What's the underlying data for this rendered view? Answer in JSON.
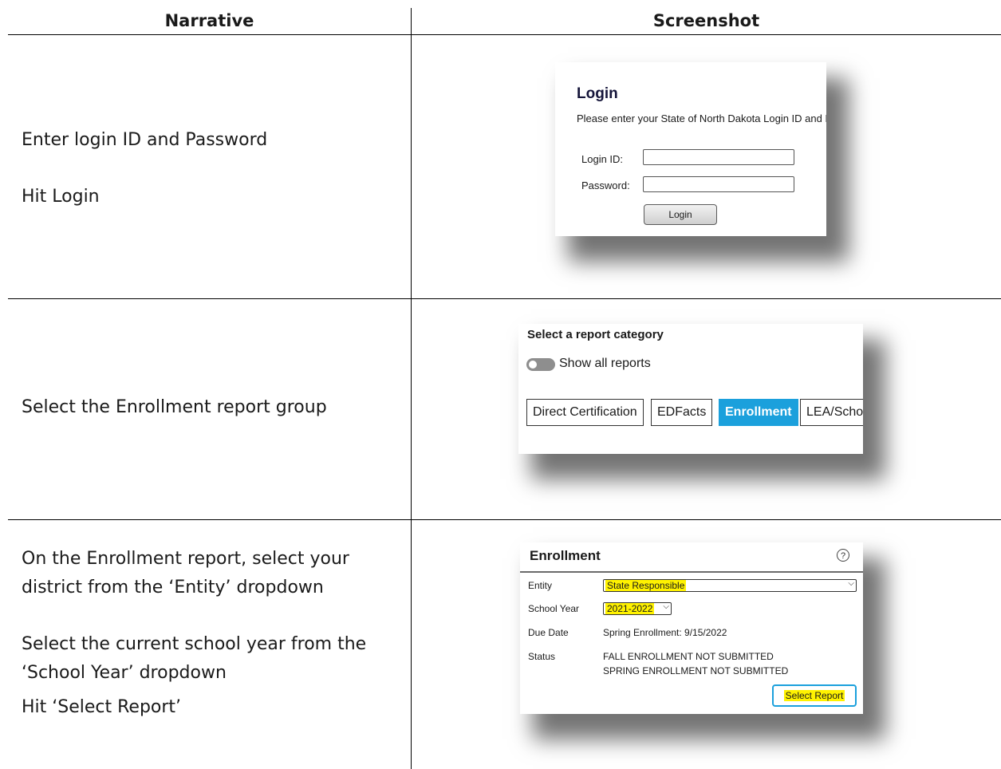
{
  "table": {
    "headers": {
      "narrative": "Narrative",
      "screenshot": "Screenshot"
    },
    "rows": [
      {
        "narrative": [
          "Enter login ID and Password",
          "Hit Login"
        ]
      },
      {
        "narrative": [
          "Select the Enrollment report group"
        ]
      },
      {
        "narrative": [
          "On the Enrollment report, select your district from the ‘Entity’ dropdown",
          "Select the current school year from the ‘School Year’ dropdown",
          "Hit ‘Select Report’"
        ]
      }
    ]
  },
  "login": {
    "title": "Login",
    "subtitle": "Please enter your State of North Dakota Login ID and Password",
    "login_id_label": "Login ID:",
    "password_label": "Password:",
    "login_id_value": "",
    "password_value": "",
    "button": "Login"
  },
  "report_category": {
    "title": "Select a report category",
    "toggle_label": "Show all reports",
    "toggle_on": false,
    "categories": [
      "Direct Certification",
      "EDFacts",
      "Enrollment",
      "LEA/School"
    ],
    "active": "Enrollment",
    "active_color": "#1ba0dc"
  },
  "enrollment": {
    "title": "Enrollment",
    "help_icon": "?",
    "entity_label": "Entity",
    "entity_value": "State Responsible",
    "school_year_label": "School Year",
    "school_year_value": "2021-2022",
    "due_date_label": "Due Date",
    "due_date_value": "Spring Enrollment: 9/15/2022",
    "status_label": "Status",
    "status_lines": [
      "FALL ENROLLMENT NOT SUBMITTED",
      "SPRING ENROLLMENT NOT SUBMITTED"
    ],
    "button": "Select Report",
    "highlight_color": "#fff200"
  }
}
